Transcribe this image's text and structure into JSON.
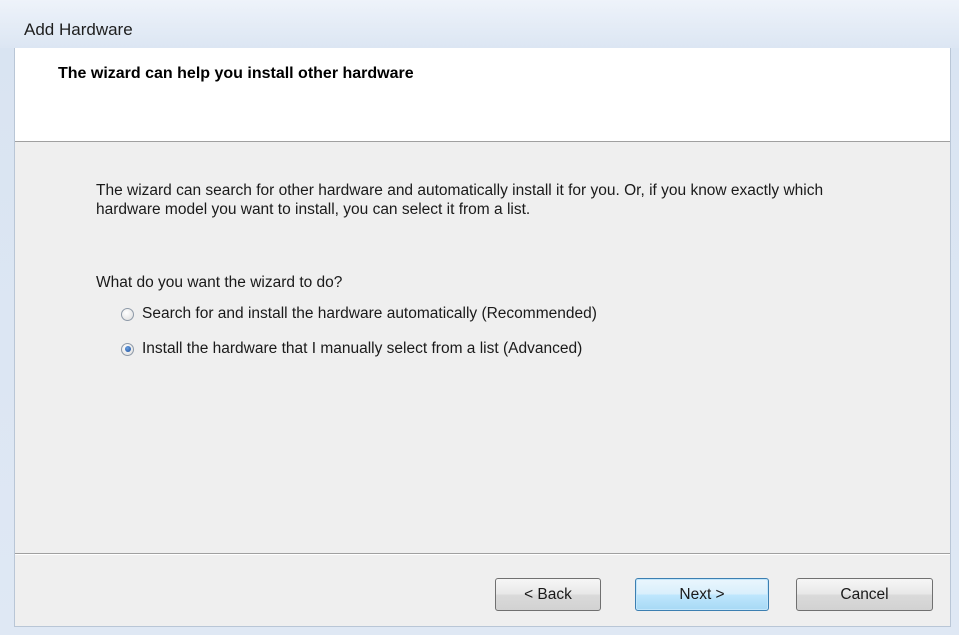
{
  "window": {
    "title": "Add Hardware"
  },
  "header": {
    "title": "The wizard can help you install other hardware"
  },
  "body": {
    "description": "The wizard can search for other hardware and automatically install it for you. Or, if you know exactly which hardware model you want to install, you can select it from a list.",
    "question": "What do you want the wizard to do?",
    "options": [
      {
        "label": "Search for and install the hardware automatically (Recommended)",
        "selected": false
      },
      {
        "label": "Install the hardware that I manually select from a list (Advanced)",
        "selected": true
      }
    ]
  },
  "buttons": {
    "back": "< Back",
    "next": "Next >",
    "cancel": "Cancel"
  },
  "colors": {
    "accent": "#3c7fb1",
    "title_bar": "#dce6f3",
    "panel": "#efefef"
  }
}
